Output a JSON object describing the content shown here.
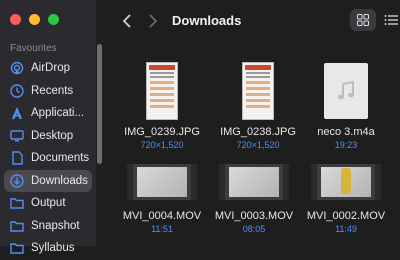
{
  "sidebar": {
    "section_title": "Favourites",
    "items": [
      {
        "label": "AirDrop",
        "icon": "airdrop-icon"
      },
      {
        "label": "Recents",
        "icon": "clock-icon"
      },
      {
        "label": "Applicati...",
        "icon": "applications-icon"
      },
      {
        "label": "Desktop",
        "icon": "desktop-icon"
      },
      {
        "label": "Documents",
        "icon": "document-icon"
      },
      {
        "label": "Downloads",
        "icon": "download-icon"
      },
      {
        "label": "Output",
        "icon": "folder-icon"
      },
      {
        "label": "Snapshot",
        "icon": "folder-icon"
      },
      {
        "label": "Syllabus",
        "icon": "folder-icon"
      }
    ],
    "active_index": 5
  },
  "toolbar": {
    "title": "Downloads",
    "back_icon": "chevron-left-icon",
    "forward_icon": "chevron-right-icon",
    "grid_view_icon": "grid-view-icon",
    "list_view_icon": "list-view-icon"
  },
  "files": [
    {
      "name": "IMG_0239.JPG",
      "meta": "720×1,520",
      "kind": "image"
    },
    {
      "name": "IMG_0238.JPG",
      "meta": "720×1,520",
      "kind": "image"
    },
    {
      "name": "neco 3.m4a",
      "meta": "19:23",
      "kind": "audio"
    },
    {
      "name": "MVI_0004.MOV",
      "meta": "11:51",
      "kind": "video"
    },
    {
      "name": "MVI_0003.MOV",
      "meta": "08:05",
      "kind": "video"
    },
    {
      "name": "MVI_0002.MOV",
      "meta": "11:49",
      "kind": "video"
    }
  ],
  "colors": {
    "accent": "#4f8ff7",
    "sidebar_bg": "#2b2a2f",
    "window_bg": "#1e1e1e",
    "close": "#ff5f57",
    "minimize": "#febc2e",
    "zoom": "#28c840"
  }
}
